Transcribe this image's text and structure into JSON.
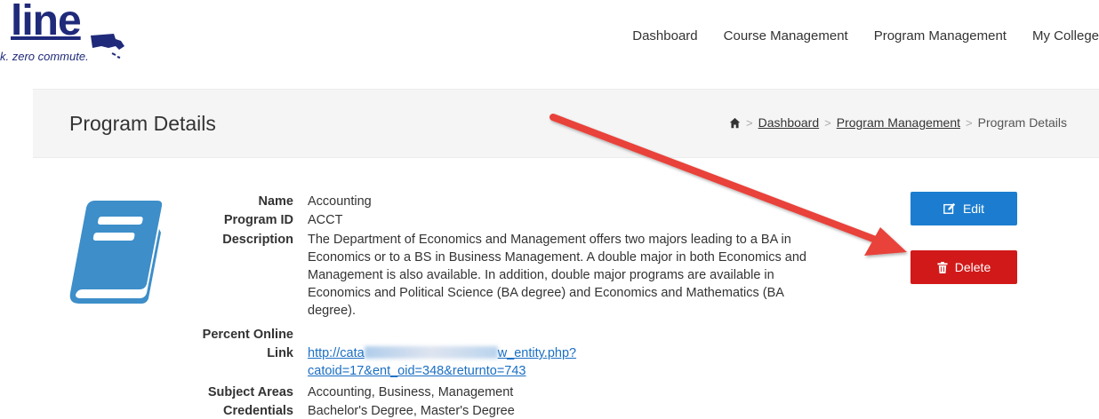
{
  "header": {
    "logo_word": "line",
    "logo_tagline": "k. zero commute.",
    "nav": [
      "Dashboard",
      "Course Management",
      "Program Management",
      "My College"
    ]
  },
  "titlebar": {
    "title": "Program Details",
    "breadcrumb": [
      "Dashboard",
      "Program Management",
      "Program Details"
    ]
  },
  "details": {
    "labels": {
      "name": "Name",
      "program_id": "Program ID",
      "description": "Description",
      "percent_online": "Percent Online",
      "link": "Link",
      "subject_areas": "Subject Areas",
      "credentials": "Credentials"
    },
    "values": {
      "name": "Accounting",
      "program_id": "ACCT",
      "description_lines": [
        "The Department of Economics and Management offers two majors leading to a BA in",
        "Economics or to a BS in Business Management. A double major in both Economics and",
        "Management is also available. In addition, double major programs are available in",
        "Economics and Political Science (BA degree) and Economics and Mathematics (BA",
        "degree)."
      ],
      "percent_online": "",
      "link_start": "http://cata",
      "link_end": "w_entity.php?",
      "link_line2": "catoid=17&ent_oid=348&returnto=743",
      "subject_areas": "Accounting, Business, Management",
      "credentials": "Bachelor's Degree, Master's Degree"
    }
  },
  "actions": {
    "edit_label": "Edit",
    "delete_label": "Delete"
  },
  "colors": {
    "edit": "#1c7dd0",
    "delete": "#d11919",
    "arrow": "#e8423a",
    "book": "#3d8ec9",
    "logo": "#1f2a7a"
  },
  "icons": [
    "home-icon",
    "book-icon",
    "edit-icon",
    "trash-icon"
  ]
}
